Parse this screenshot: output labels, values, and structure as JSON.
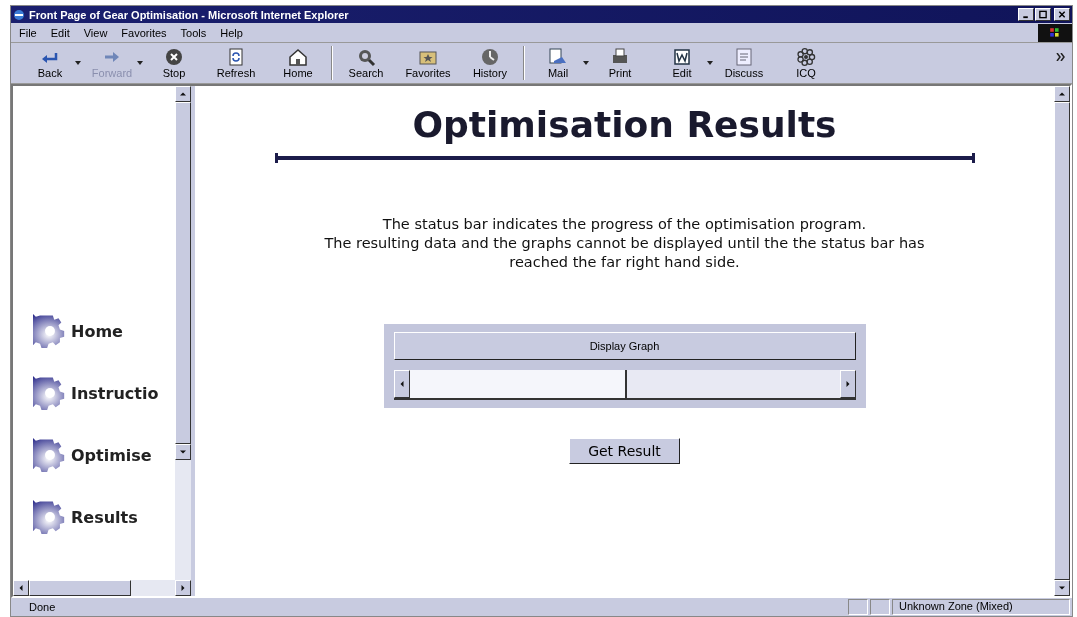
{
  "window": {
    "title": "Front Page of Gear Optimisation - Microsoft Internet Explorer"
  },
  "menu": [
    "File",
    "Edit",
    "View",
    "Favorites",
    "Tools",
    "Help"
  ],
  "toolbar": [
    {
      "label": "Back",
      "disabled": false,
      "dropdown": true
    },
    {
      "label": "Forward",
      "disabled": true,
      "dropdown": true
    },
    {
      "label": "Stop",
      "disabled": false,
      "dropdown": false
    },
    {
      "label": "Refresh",
      "disabled": false,
      "dropdown": false
    },
    {
      "label": "Home",
      "disabled": false,
      "dropdown": false
    },
    {
      "label": "Search",
      "disabled": false,
      "dropdown": false
    },
    {
      "label": "Favorites",
      "disabled": false,
      "dropdown": false
    },
    {
      "label": "History",
      "disabled": false,
      "dropdown": false
    },
    {
      "label": "Mail",
      "disabled": false,
      "dropdown": true
    },
    {
      "label": "Print",
      "disabled": false,
      "dropdown": false
    },
    {
      "label": "Edit",
      "disabled": false,
      "dropdown": true
    },
    {
      "label": "Discuss",
      "disabled": false,
      "dropdown": false
    },
    {
      "label": "ICQ",
      "disabled": false,
      "dropdown": false
    }
  ],
  "sidebar": {
    "items": [
      "Home",
      "Instructio",
      "Optimise",
      "Results"
    ]
  },
  "page": {
    "heading": "Optimisation Results",
    "lines": [
      "The status bar indicates the progress of the optimisation program.",
      "The resulting data and the graphs cannot be displayed until the the status bar has",
      "reached the far right hand side."
    ],
    "applet": {
      "button": "Display Graph",
      "progress": {
        "level": 0.5
      }
    },
    "button": "Get Result"
  },
  "status_bar": {
    "text": "Done",
    "zone": "Unknown Zone (Mixed)"
  }
}
